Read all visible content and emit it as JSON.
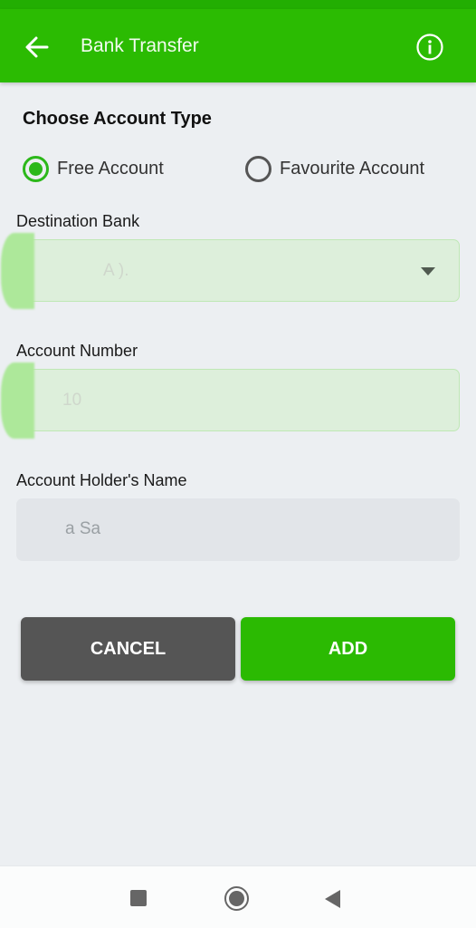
{
  "app_bar": {
    "title": "Bank Transfer",
    "back_icon": "arrow-left-icon",
    "info_icon": "info-circle-icon"
  },
  "account_type": {
    "title": "Choose Account Type",
    "options": [
      {
        "label": "Free Account",
        "checked": true
      },
      {
        "label": "Favourite Account",
        "checked": false
      }
    ]
  },
  "form": {
    "destination_bank": {
      "label": "Destination Bank",
      "value": "A  ).",
      "icon": "dropdown-arrow-icon"
    },
    "account_number": {
      "label": "Account Number",
      "value": "10"
    },
    "account_holder": {
      "label": "Account Holder's Name",
      "value": "a  Sa"
    }
  },
  "buttons": {
    "cancel": "CANCEL",
    "add": "ADD"
  },
  "colors": {
    "primary": "#2bbb02",
    "status_bar": "#22ae02",
    "cancel": "#555555",
    "radio_checked": "#2cb81a"
  },
  "nav_bar": {
    "recents_icon": "square-icon",
    "home_icon": "circle-icon",
    "back_icon": "triangle-back-icon"
  }
}
